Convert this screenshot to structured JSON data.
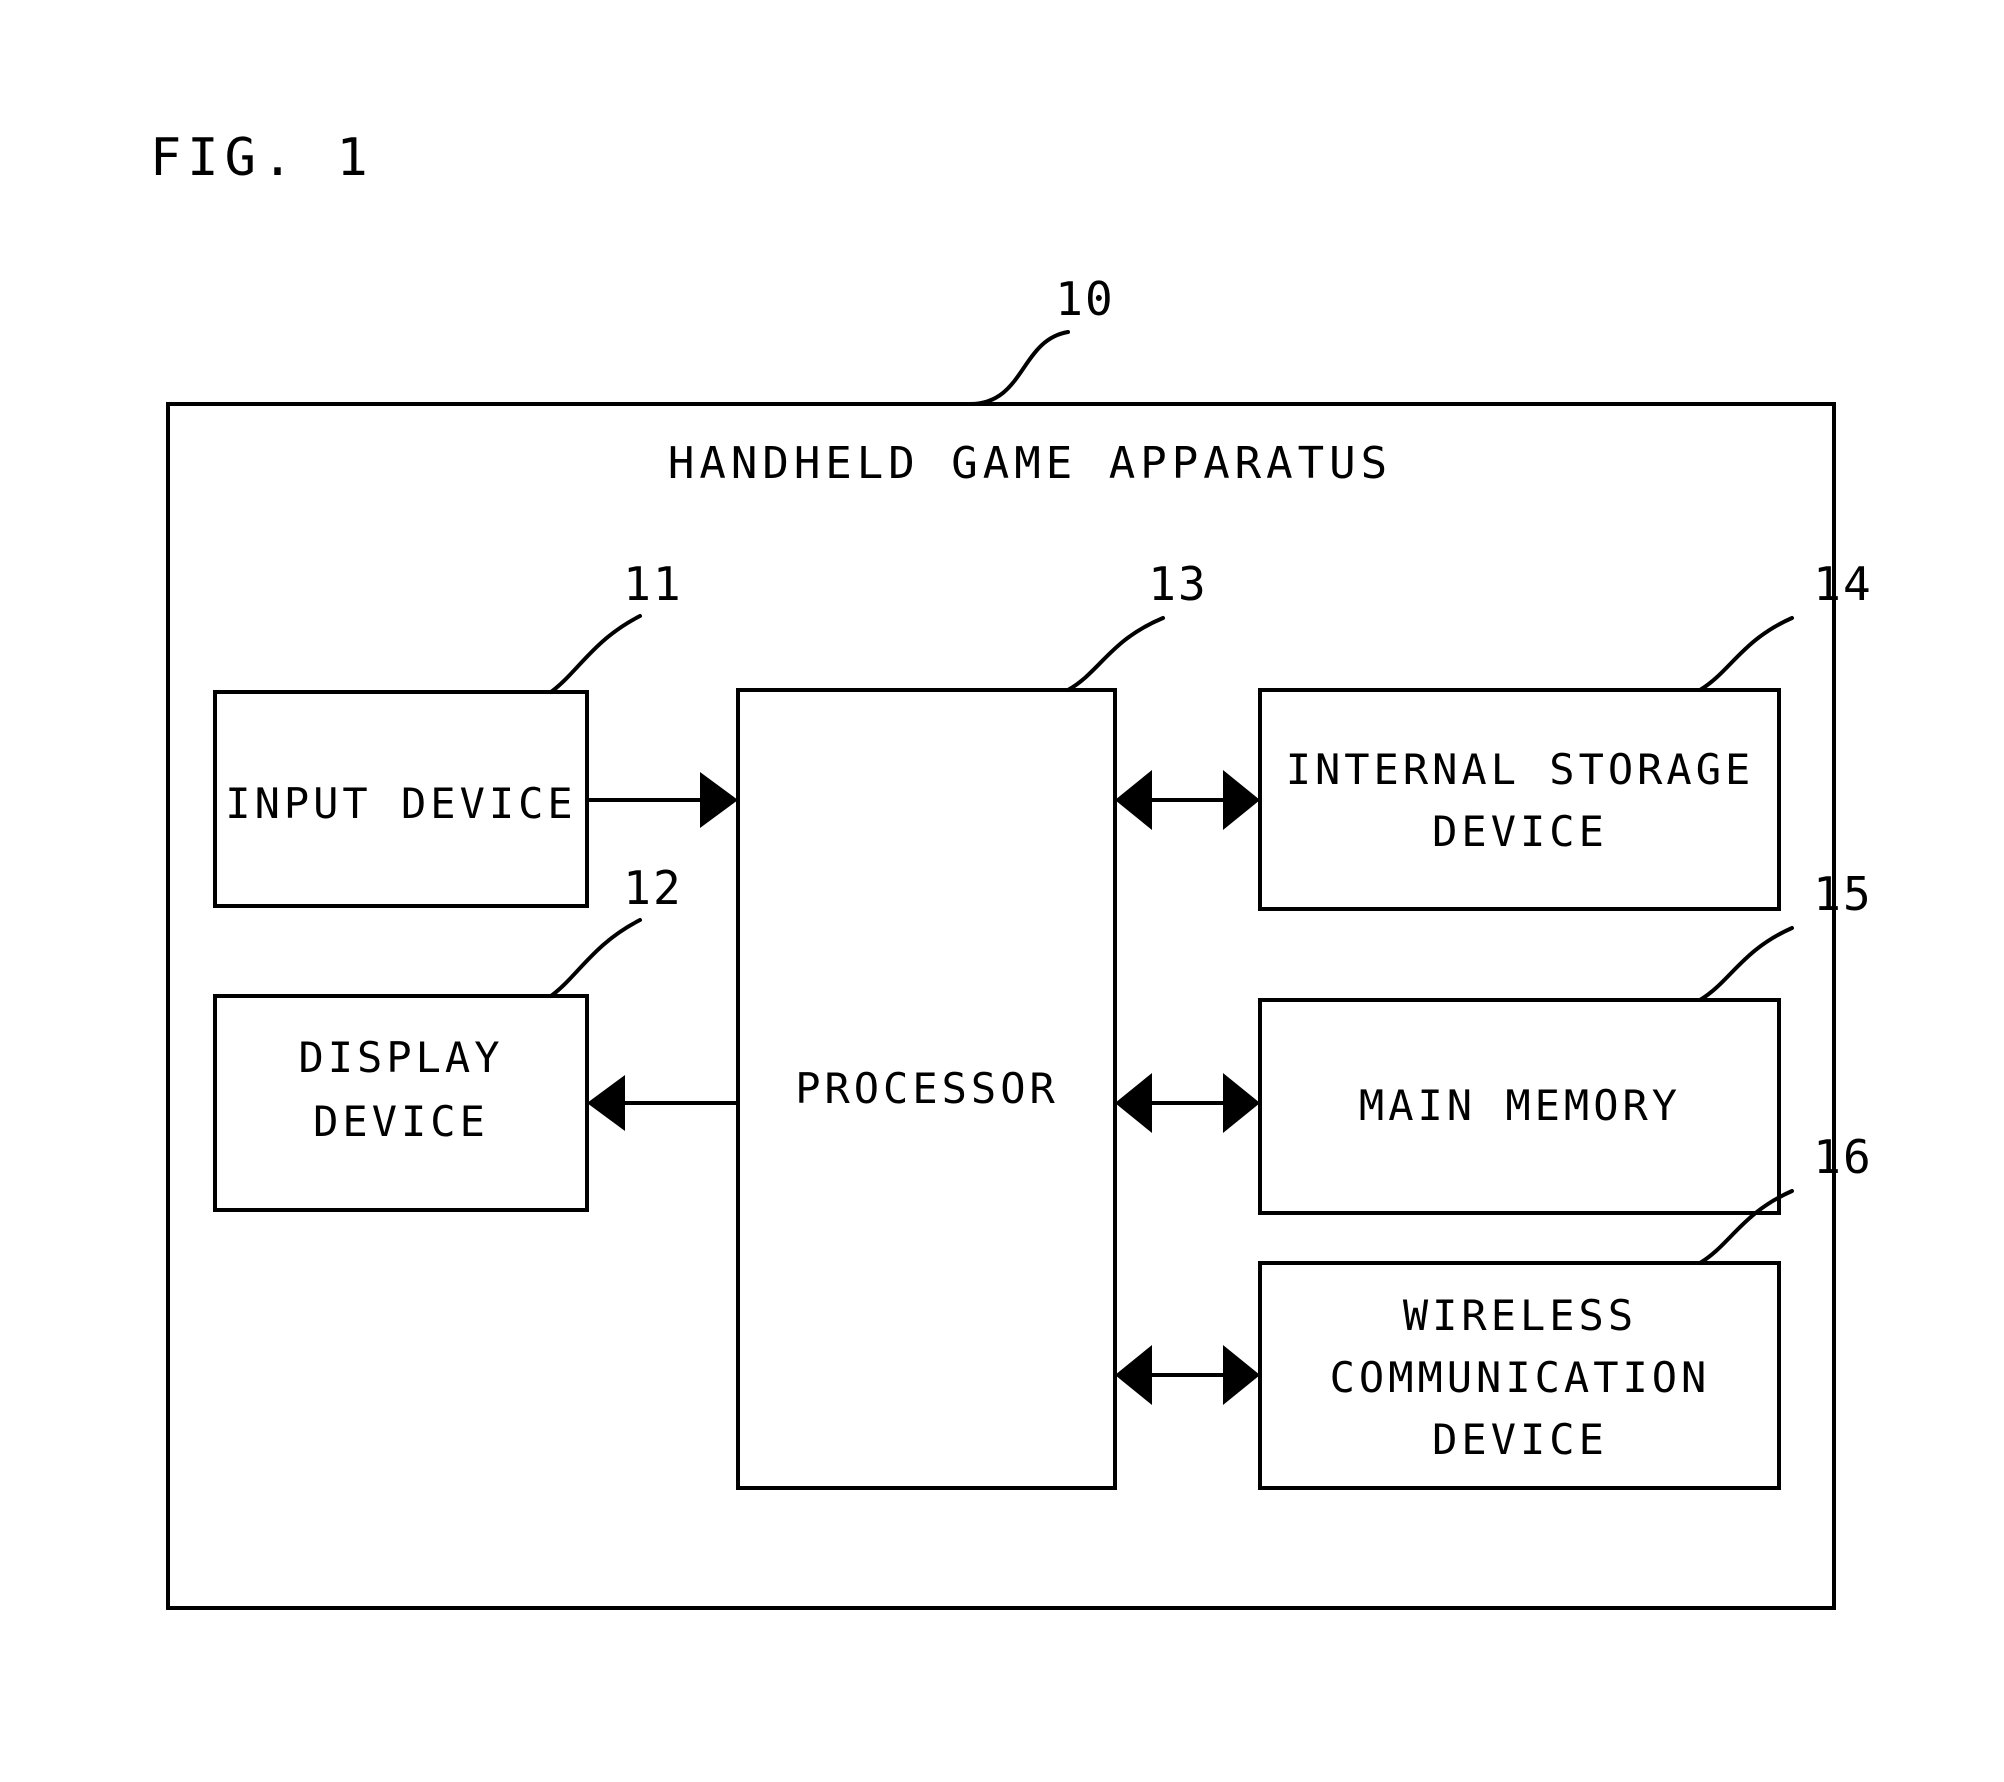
{
  "figure": {
    "label": "FIG. 1",
    "type": "patent-block-diagram"
  },
  "outer_block": {
    "ref": "10",
    "title": "HANDHELD GAME APPARATUS"
  },
  "blocks": [
    {
      "id": "input-device",
      "ref": "11",
      "lines": [
        "INPUT DEVICE"
      ]
    },
    {
      "id": "display-device",
      "ref": "12",
      "lines": [
        "DISPLAY",
        "DEVICE"
      ]
    },
    {
      "id": "processor",
      "ref": "13",
      "lines": [
        "PROCESSOR"
      ]
    },
    {
      "id": "internal-storage-device",
      "ref": "14",
      "lines": [
        "INTERNAL STORAGE",
        "DEVICE"
      ]
    },
    {
      "id": "main-memory",
      "ref": "15",
      "lines": [
        "MAIN MEMORY"
      ]
    },
    {
      "id": "wireless-communication-device",
      "ref": "16",
      "lines": [
        "WIRELESS",
        "COMMUNICATION",
        "DEVICE"
      ]
    }
  ],
  "connections": [
    {
      "id": "input-to-processor",
      "from": "input-device",
      "to": "processor",
      "direction": "unidirectional-right"
    },
    {
      "id": "processor-to-display",
      "from": "processor",
      "to": "display-device",
      "direction": "unidirectional-left"
    },
    {
      "id": "processor-internal-storage",
      "from": "processor",
      "to": "internal-storage-device",
      "direction": "bidirectional"
    },
    {
      "id": "processor-main-memory",
      "from": "processor",
      "to": "main-memory",
      "direction": "bidirectional"
    },
    {
      "id": "processor-wireless",
      "from": "processor",
      "to": "wireless-communication-device",
      "direction": "bidirectional"
    }
  ],
  "colors": {
    "ink": "#000000",
    "paper": "#ffffff"
  }
}
